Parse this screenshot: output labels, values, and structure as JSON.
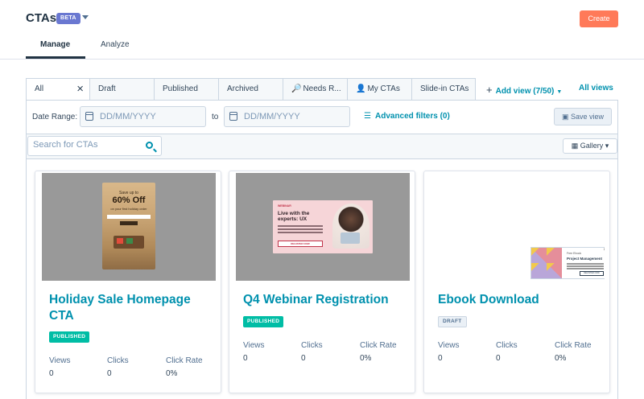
{
  "header": {
    "title": "CTAs",
    "badge": "BETA",
    "create_label": "Create",
    "tabs": [
      {
        "label": "Manage",
        "active": true
      },
      {
        "label": "Analyze",
        "active": false
      }
    ]
  },
  "view_tabs": [
    {
      "label": "All",
      "icon": "",
      "active": true,
      "closable": true
    },
    {
      "label": "Draft",
      "icon": "",
      "active": false
    },
    {
      "label": "Published",
      "icon": "",
      "active": false
    },
    {
      "label": "Archived",
      "icon": "",
      "active": false
    },
    {
      "label": "Needs R...",
      "icon": "magnifier-icon",
      "active": false
    },
    {
      "label": "My CTAs",
      "icon": "person-icon",
      "active": false
    },
    {
      "label": "Slide-in CTAs",
      "icon": "",
      "active": false
    }
  ],
  "add_view_label": "Add view (7/50)",
  "all_views_label": "All views",
  "filters": {
    "date_range_label": "Date Range:",
    "start_placeholder": "DD/MM/YYYY",
    "to_label": "to",
    "end_placeholder": "DD/MM/YYYY",
    "advanced_label": "Advanced filters (0)",
    "save_view_label": "Save view"
  },
  "search": {
    "placeholder": "Search for CTAs",
    "value": ""
  },
  "view_mode_label": "Gallery",
  "stat_labels": {
    "views": "Views",
    "clicks": "Clicks",
    "rate": "Click Rate"
  },
  "cards": [
    {
      "title": "Holiday Sale Homepage CTA",
      "status": "PUBLISHED",
      "views": "0",
      "clicks": "0",
      "rate": "0%",
      "thumb_text": {
        "eyebrow": "Save up to",
        "headline": "60% Off",
        "sub": "on your first holiday order"
      }
    },
    {
      "title": "Q4 Webinar Registration",
      "status": "PUBLISHED",
      "views": "0",
      "clicks": "0",
      "rate": "0%",
      "thumb_text": {
        "eyebrow": "WEBINAR",
        "headline": "Live with the experts: UX",
        "button": "REGISTER NOW"
      }
    },
    {
      "title": "Ebook Download",
      "status": "DRAFT",
      "views": "0",
      "clicks": "0",
      "rate": "0%",
      "thumb_text": {
        "eyebrow": "Free Ebook",
        "headline": "Project Management",
        "button": "REGISTER NOW"
      }
    }
  ],
  "colors": {
    "accent": "#0091ae",
    "create": "#ff7a59",
    "published": "#00bda5",
    "beta": "#6a78d1"
  }
}
